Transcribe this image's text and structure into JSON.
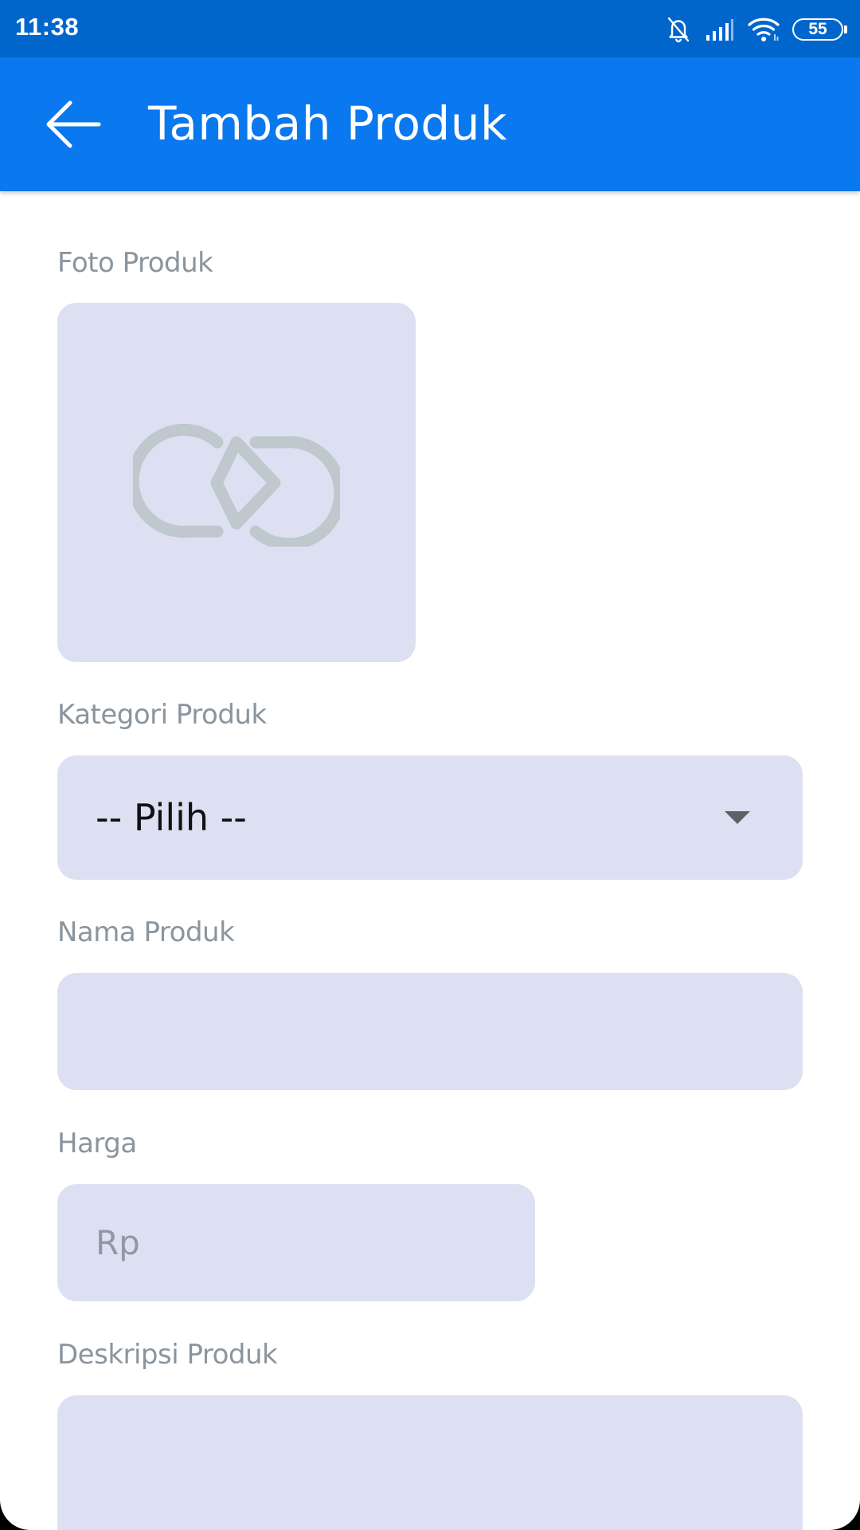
{
  "status_bar": {
    "time": "11:38",
    "battery": "55",
    "icons": [
      "bell-muted-icon",
      "signal-icon",
      "wifi-icon",
      "battery-icon"
    ],
    "color": "#0066cc"
  },
  "app_bar": {
    "title": "Tambah Produk",
    "back_icon": "arrow-left-icon",
    "color": "#0a78ee"
  },
  "form": {
    "photo": {
      "label": "Foto Produk",
      "placeholder_icon": "product-logo-placeholder-icon"
    },
    "category": {
      "label": "Kategori Produk",
      "selected": "-- Pilih --"
    },
    "name": {
      "label": "Nama Produk",
      "value": "",
      "placeholder": ""
    },
    "price": {
      "label": "Harga",
      "value": "",
      "placeholder": "Rp"
    },
    "description": {
      "label": "Deskripsi Produk",
      "value": "",
      "placeholder": ""
    },
    "field_background": "#dde0f2",
    "label_color": "#8a959e"
  }
}
